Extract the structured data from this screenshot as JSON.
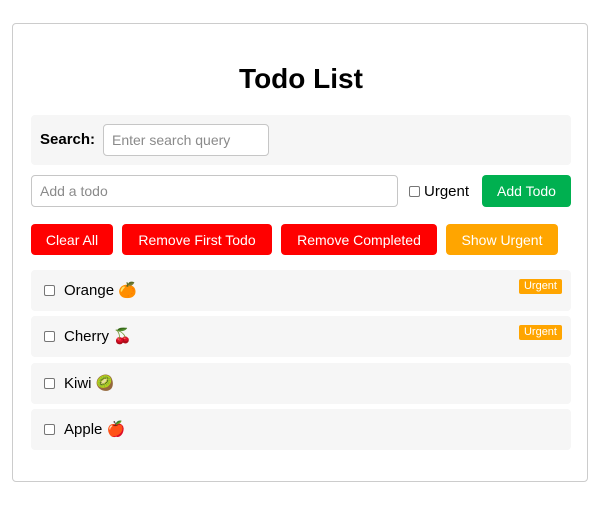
{
  "header": {
    "title": "Todo List"
  },
  "search": {
    "label": "Search:",
    "placeholder": "Enter search query",
    "value": ""
  },
  "add": {
    "placeholder": "Add a todo",
    "value": "",
    "urgent_label": "Urgent",
    "urgent_checked": false,
    "button_label": "Add Todo"
  },
  "actions": {
    "clear_all": "Clear All",
    "remove_first": "Remove First Todo",
    "remove_completed": "Remove Completed",
    "show_urgent": "Show Urgent"
  },
  "todos": [
    {
      "text": "Orange 🍊",
      "urgent": true,
      "badge": "Urgent",
      "completed": false
    },
    {
      "text": "Cherry 🍒",
      "urgent": true,
      "badge": "Urgent",
      "completed": false
    },
    {
      "text": "Kiwi 🥝",
      "urgent": false,
      "badge": "",
      "completed": false
    },
    {
      "text": "Apple 🍎",
      "urgent": false,
      "badge": "",
      "completed": false
    }
  ],
  "colors": {
    "add_button": "#00b050",
    "danger_button": "#ff0000",
    "urgent_button": "#ffa500",
    "urgent_badge": "#ffa500",
    "row_background": "#f6f6f6"
  }
}
